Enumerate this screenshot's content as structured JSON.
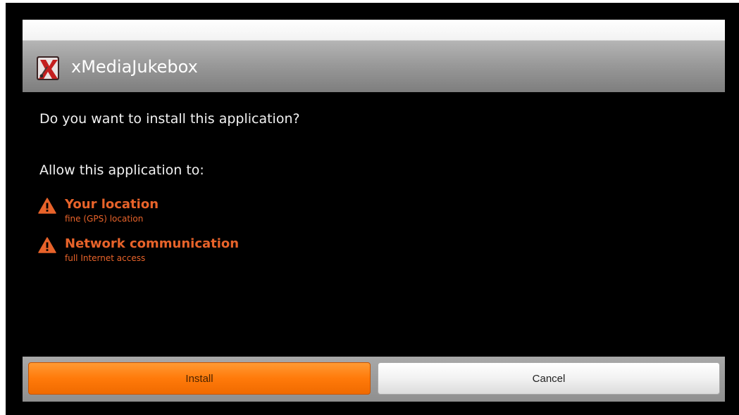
{
  "dialog": {
    "app_name": "xMediaJukebox",
    "prompt": "Do you want to install this application?",
    "allow_label": "Allow this application to:",
    "permissions": [
      {
        "title": "Your location",
        "description": "fine (GPS) location"
      },
      {
        "title": "Network communication",
        "description": "full Internet access"
      }
    ],
    "buttons": {
      "install": "Install",
      "cancel": "Cancel"
    }
  },
  "colors": {
    "warning_orange": "#e8632a",
    "install_button": "#ff7a0a",
    "background": "#000000"
  },
  "icons": {
    "app": "app-icon",
    "warning": "warning-icon"
  }
}
